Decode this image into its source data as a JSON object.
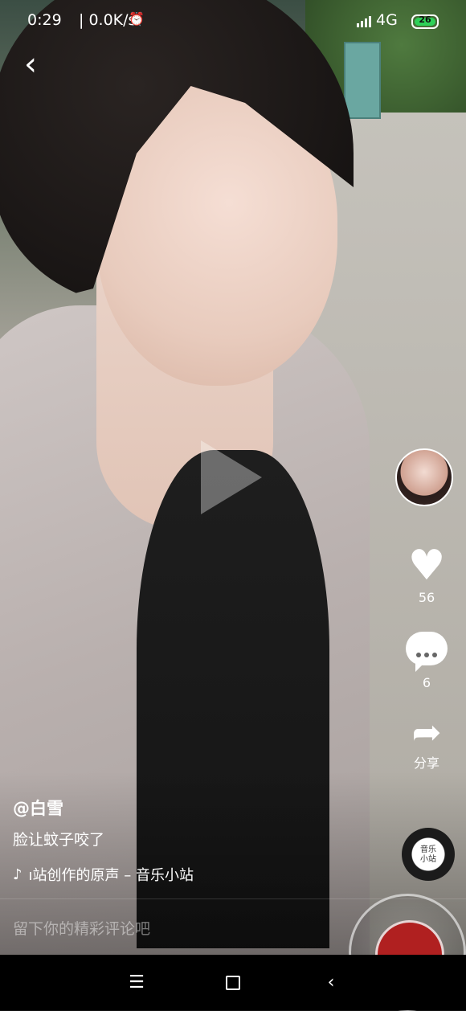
{
  "status_bar": {
    "time": "0:29",
    "net_speed": "| 0.0K/s",
    "alarm_icon": "alarm-icon",
    "network": "4G",
    "battery": "26",
    "battery_color": "#2ed158"
  },
  "video": {
    "play_icon": "play-icon"
  },
  "side_actions": {
    "likes": "56",
    "comments": "6",
    "share_label": "分享"
  },
  "post": {
    "username": "@白雪",
    "caption": "脸让蚊子咬了",
    "music": "ı站创作的原声 – 音乐小站"
  },
  "music_disc": {
    "label_line1": "音乐",
    "label_line2": "小站"
  },
  "comment_input": {
    "placeholder": "留下你的精彩评论吧"
  }
}
